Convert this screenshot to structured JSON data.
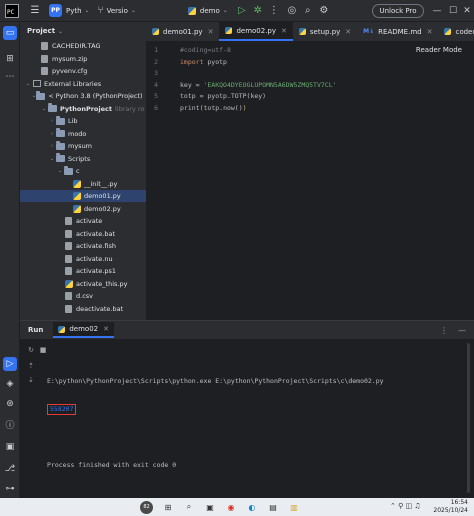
{
  "titlebar": {
    "project_badge": "PP",
    "project_name": "Pyth",
    "vcs_label": "Versio",
    "run_config": "demo",
    "unlock_label": "Unlock Pro"
  },
  "project_panel": {
    "title": "Project",
    "tree": [
      {
        "label": "CACHEDIR.TAG",
        "kind": "file",
        "indent": 1,
        "arrow": ""
      },
      {
        "label": "mysum.zip",
        "kind": "file",
        "indent": 1,
        "arrow": ""
      },
      {
        "label": "pyvenv.cfg",
        "kind": "file",
        "indent": 1,
        "arrow": ""
      },
      {
        "label": "External Libraries",
        "kind": "lib",
        "indent": 0,
        "arrow": "v"
      },
      {
        "label": "< Python 3.8 (PythonProject)",
        "kind": "folder",
        "indent": 1,
        "arrow": "v",
        "suffix": "E:"
      },
      {
        "label": "PythonProject",
        "kind": "folder",
        "indent": 2,
        "arrow": "v",
        "suffix": "library ro",
        "bold": true
      },
      {
        "label": "Lib",
        "kind": "folder",
        "indent": 3,
        "arrow": ">"
      },
      {
        "label": "modo",
        "kind": "folder",
        "indent": 3,
        "arrow": ">"
      },
      {
        "label": "mysum",
        "kind": "folder",
        "indent": 3,
        "arrow": ">"
      },
      {
        "label": "Scripts",
        "kind": "folder",
        "indent": 3,
        "arrow": "v"
      },
      {
        "label": "c",
        "kind": "folder",
        "indent": 4,
        "arrow": "v"
      },
      {
        "label": "__init__.py",
        "kind": "py",
        "indent": 5,
        "arrow": ""
      },
      {
        "label": "demo01.py",
        "kind": "py",
        "indent": 5,
        "arrow": "",
        "selected": true
      },
      {
        "label": "demo02.py",
        "kind": "py",
        "indent": 5,
        "arrow": ""
      },
      {
        "label": "activate",
        "kind": "file",
        "indent": 4,
        "arrow": ""
      },
      {
        "label": "activate.bat",
        "kind": "file",
        "indent": 4,
        "arrow": ""
      },
      {
        "label": "activate.fish",
        "kind": "file",
        "indent": 4,
        "arrow": ""
      },
      {
        "label": "activate.nu",
        "kind": "file",
        "indent": 4,
        "arrow": ""
      },
      {
        "label": "activate.ps1",
        "kind": "file",
        "indent": 4,
        "arrow": ""
      },
      {
        "label": "activate_this.py",
        "kind": "py",
        "indent": 4,
        "arrow": ""
      },
      {
        "label": "d.csv",
        "kind": "file",
        "indent": 4,
        "arrow": ""
      },
      {
        "label": "deactivate.bat",
        "kind": "file",
        "indent": 4,
        "arrow": ""
      }
    ]
  },
  "tabs": [
    {
      "label": "demo01.py",
      "icon": "py",
      "active": false
    },
    {
      "label": "demo02.py",
      "icon": "py",
      "active": true
    },
    {
      "label": "setup.py",
      "icon": "py",
      "active": false
    },
    {
      "label": "README.md",
      "icon": "md",
      "active": false
    },
    {
      "label": "codecs",
      "icon": "py",
      "active": false
    }
  ],
  "editor": {
    "reader_mode": "Reader Mode",
    "lines": [
      [
        {
          "t": "#coding=utf-8",
          "c": "comment"
        }
      ],
      [
        {
          "t": "import",
          "c": "kw"
        },
        {
          "t": " pyotp",
          "c": "def"
        }
      ],
      [],
      [
        {
          "t": "key = ",
          "c": "def"
        },
        {
          "t": "'EAKQO4DYEOGLUPOMN5A6DW5ZMQ5TV7CL'",
          "c": "str"
        }
      ],
      [
        {
          "t": "totp = pyotp.TOTP(key)",
          "c": "def"
        }
      ],
      [
        {
          "t": "print",
          "c": "def"
        },
        {
          "t": "(",
          "c": "paren"
        },
        {
          "t": "totp.now()",
          "c": "def"
        },
        {
          "t": ")",
          "c": "paren"
        }
      ]
    ]
  },
  "run": {
    "title": "Run",
    "tab_label": "demo02",
    "command": "E:\\python\\PythonProject\\Scripts\\python.exe E:\\python\\PythonProject\\Scripts\\c\\demo02.py",
    "otp_output": "558207",
    "exit_message": "Process finished with exit code 0"
  },
  "taskbar": {
    "weather_temp": "82",
    "time": "16:54",
    "date": "2025/10/24"
  }
}
